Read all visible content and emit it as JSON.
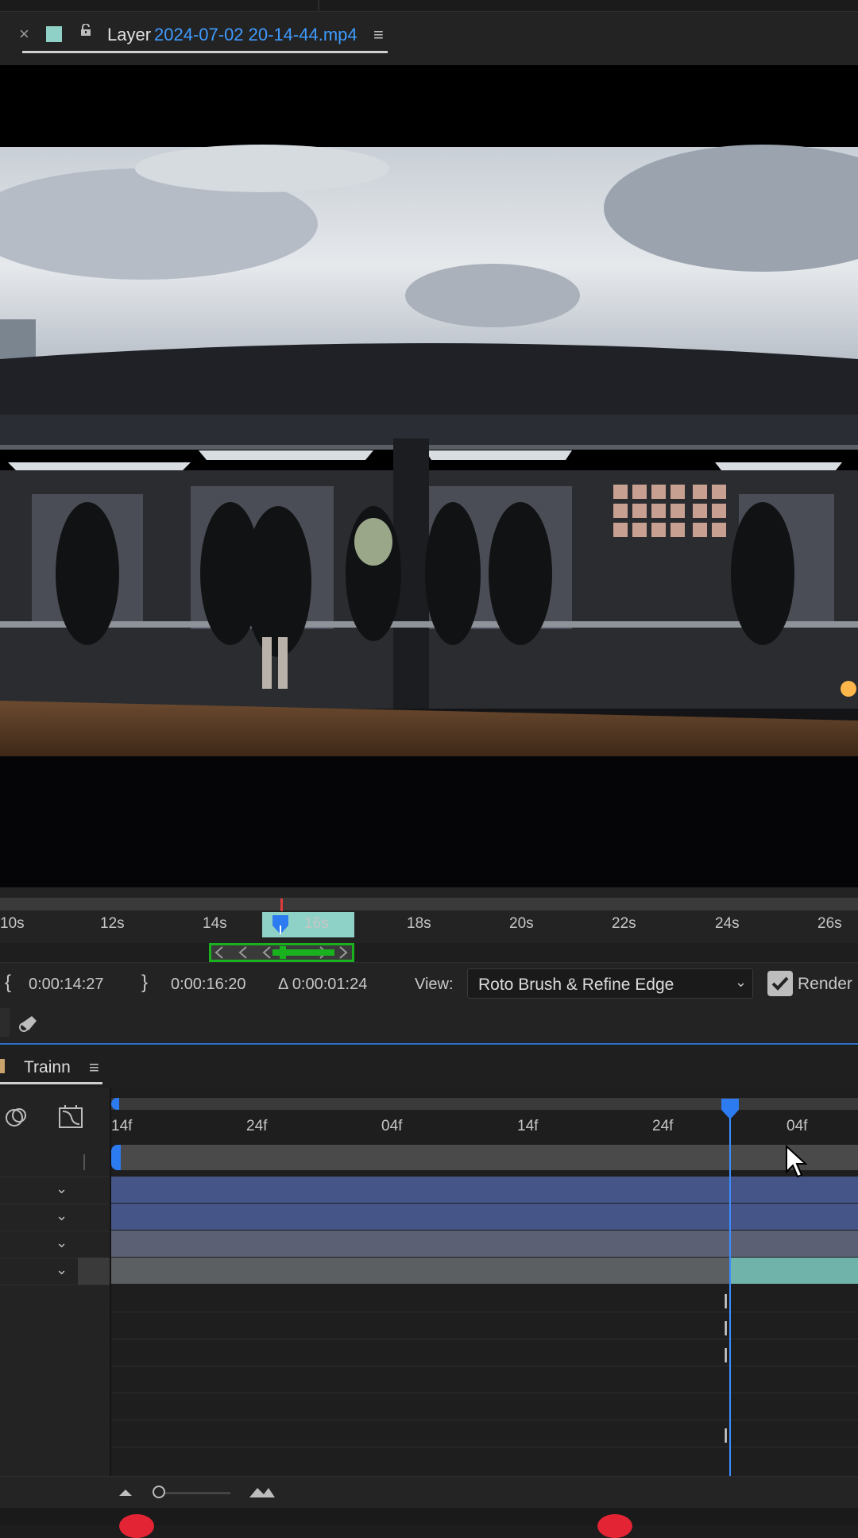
{
  "layer_panel": {
    "close_glyph": "×",
    "label": "Layer",
    "file_name": "2024-07-02 20-14-44.mp4",
    "menu_glyph": "≡",
    "swatch_color": "#8fd1c7"
  },
  "layer_ruler": {
    "ticks": [
      "10s",
      "12s",
      "14s",
      "16s",
      "18s",
      "20s",
      "22s",
      "24s",
      "26s"
    ]
  },
  "inout": {
    "in_bracket": "{",
    "in_time": "0:00:14:27",
    "out_bracket": "}",
    "out_time": "0:00:16:20",
    "duration": "Δ 0:00:01:24",
    "view_label": "View:",
    "view_value": "Roto Brush & Refine Edge",
    "render_label": "Render",
    "render_checked": true
  },
  "timeline": {
    "tab_label": "Trainn",
    "tab_menu_glyph": "≡",
    "ruler_ticks": [
      "14f",
      "24f",
      "04f",
      "14f",
      "24f",
      "04f"
    ],
    "accent_color": "#3b8cff",
    "roto_color": "#19b21e"
  }
}
